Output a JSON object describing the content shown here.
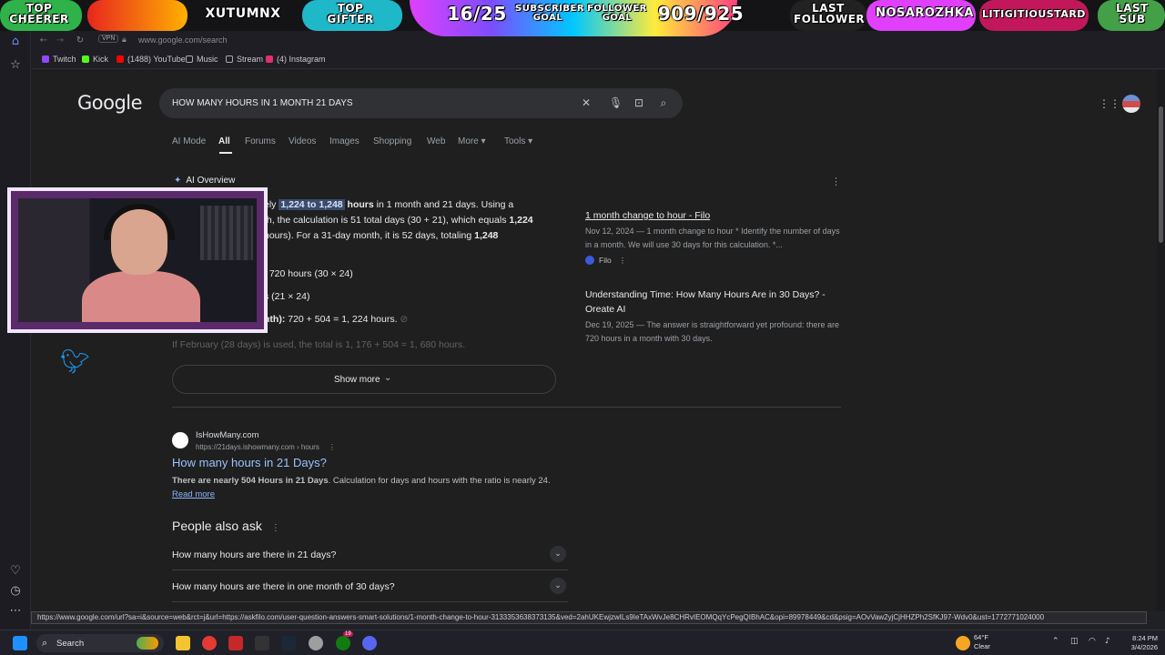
{
  "overlay": {
    "top_cheerer": "TOP\nCHEERER",
    "top_cheerer_l1": "TOP",
    "top_cheerer_l2": "CHEERER",
    "cheerer_name": "XUTUMNX",
    "top_gifter_l1": "TOP",
    "top_gifter_l2": "GIFTER",
    "subscriber_count": "16/25",
    "subscriber_goal_l1": "SUBSCRIBER",
    "subscriber_goal_l2": "GOAL",
    "follower_goal_l1": "FOLLOWER",
    "follower_goal_l2": "GOAL",
    "follower_count": "909/925",
    "last_follower_l1": "LAST",
    "last_follower_l2": "FOLLOWER",
    "follower_name": "NOSAROZHKA",
    "sub_name": "LITIGITIOUSTARD",
    "last_sub_l1": "LAST",
    "last_sub_l2": "SUB"
  },
  "browser": {
    "url": "www.google.com/search",
    "vpn": "VPN",
    "bookmarks": [
      "Twitch",
      "Kick",
      "(1488) YouTube",
      "Music",
      "Stream",
      "(4) Instagram"
    ]
  },
  "google": {
    "logo": "Google",
    "query": "HOW MANY HOURS IN 1 MONTH 21 DAYS",
    "tabs": [
      "AI Mode",
      "All",
      "Forums",
      "Videos",
      "Images",
      "Shopping",
      "Web",
      "More ▾",
      "Tools ▾"
    ],
    "ai_overview_label": "AI Overview",
    "aio": {
      "l1_pre": "ely ",
      "l1_hl": "1,224 to 1,248",
      "l1_b": " hours",
      "l1_post": " in 1 month and 21 days. Using a",
      "l2_pre": "th, the calculation is 51 total days (30 + 21), which equals ",
      "l2_b": "1,224",
      "l3_pre": "hours). For a 31-day month, it is 52 days, totaling ",
      "l3_b": "1,248",
      "l4": ": 720 hours (30 × 24)",
      "l5": "s (21 × 24)",
      "l6_b": "nth):",
      "l6_post": " 720 + 504 = 1, 224 hours.",
      "l7": "If February (28 days) is used, the total is 1, 176 + 504 = 1, 680 hours."
    },
    "sources": [
      {
        "title": "1 month change to hour - Filo",
        "snippet": "Nov 12, 2024 — 1 month change to hour * Identify the number of days in a month. We will use 30 days for this calculation. *...",
        "site": "Filo"
      },
      {
        "title": "Understanding Time: How Many Hours Are in 30 Days? - Oreate AI",
        "snippet": "Dec 19, 2025 — The answer is straightforward yet profound: there are 720 hours in a month with 30 days."
      }
    ],
    "show_more": "Show more",
    "result": {
      "site": "IsHowMany.com",
      "url": "https://21days.ishowmany.com › hours",
      "title": "How many hours in 21 Days?",
      "snippet_b": "There are nearly 504 Hours in 21 Days",
      "snippet": ". Calculation for days and hours with the ratio is nearly 24. ",
      "read_more": "Read more"
    },
    "paa_title": "People also ask",
    "paa": [
      "How many hours are there in 21 days?",
      "How many hours are there in one month of 30 days?"
    ]
  },
  "status_url": "https://www.google.com/url?sa=i&source=web&rct=j&url=https://askfilo.com/user-question-answers-smart-solutions/1-month-change-to-hour-3133353638373135&ved=2ahUKEwjzwILs9IeTAxWvJe8CHRvIEOMQqYcPegQIBhAC&opi=89978449&cd&psig=AOvVaw2yjCjHHZPh2SfKJ97-Wdv0&ust=1772771024000",
  "taskbar": {
    "search": "Search",
    "weather_temp": "64°F",
    "weather_cond": "Clear",
    "time": "8:24 PM",
    "date": "3/4/2026",
    "badge_count": "19"
  },
  "colors": {
    "accent_blue": "#8ab4f8",
    "link_blue": "#99c3ff",
    "highlight": "#3c4a6b",
    "twitter": "#1d9bf0"
  }
}
